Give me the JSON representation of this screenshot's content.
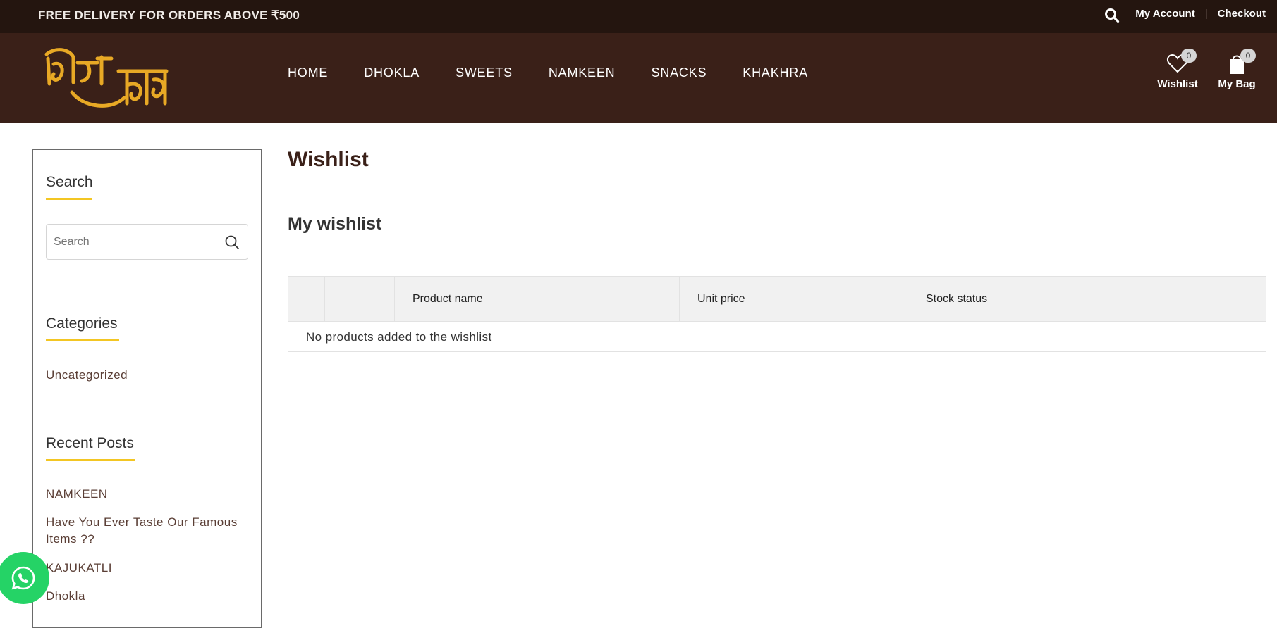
{
  "topbar": {
    "promo": "FREE DELIVERY FOR ORDERS ABOVE ₹500",
    "my_account": "My Account",
    "separator": "|",
    "checkout": "Checkout"
  },
  "header": {
    "nav": [
      "HOME",
      "DHOKLA",
      "SWEETS",
      "NAMKEEN",
      "SNACKS",
      "KHAKHRA"
    ],
    "wishlist_label": "Wishlist",
    "wishlist_count": "0",
    "bag_label": "My Bag",
    "bag_count": "0"
  },
  "sidebar": {
    "search_title": "Search",
    "search_placeholder": "Search",
    "categories_title": "Categories",
    "categories": [
      "Uncategorized"
    ],
    "recent_title": "Recent Posts",
    "recent_posts": [
      "NAMKEEN",
      "Have You Ever Taste Our Famous Items ??",
      "KAJUKATLI",
      "Dhokla"
    ]
  },
  "main": {
    "title": "Wishlist",
    "subtitle": "My wishlist",
    "columns": [
      "",
      "",
      "Product name",
      "Unit price",
      "Stock status",
      ""
    ],
    "empty_message": "No products added to the wishlist"
  },
  "colors": {
    "topbar_bg": "#24150f",
    "header_bg": "#3a2018",
    "accent": "#f3c623",
    "whatsapp": "#25d366"
  }
}
